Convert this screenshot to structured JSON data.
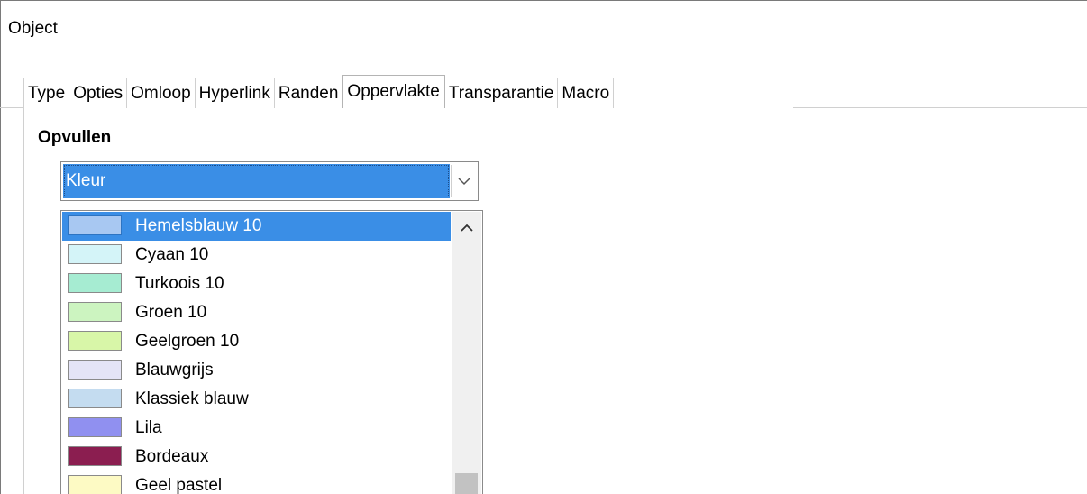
{
  "dialog": {
    "title": "Object"
  },
  "tabs": [
    {
      "label": "Type"
    },
    {
      "label": "Opties"
    },
    {
      "label": "Omloop"
    },
    {
      "label": "Hyperlink"
    },
    {
      "label": "Randen"
    },
    {
      "label": "Oppervlakte",
      "active": true
    },
    {
      "label": "Transparantie"
    },
    {
      "label": "Macro"
    }
  ],
  "fill": {
    "section_label": "Opvullen",
    "type_select": {
      "value": "Kleur",
      "icon": "chevron-down-icon"
    },
    "color_list": {
      "scroll_up_icon": "chevron-up-icon",
      "items": [
        {
          "label": "Hemelsblauw 10",
          "color": "#a8c8f2",
          "selected": true
        },
        {
          "label": "Cyaan 10",
          "color": "#d4f4f8"
        },
        {
          "label": "Turkoois 10",
          "color": "#a6ecd2"
        },
        {
          "label": "Groen 10",
          "color": "#ccf4c0"
        },
        {
          "label": "Geelgroen 10",
          "color": "#d8f6a8"
        },
        {
          "label": "Blauwgrijs",
          "color": "#e4e4f6"
        },
        {
          "label": "Klassiek blauw",
          "color": "#c4dcf0"
        },
        {
          "label": "Lila",
          "color": "#9090f0"
        },
        {
          "label": "Bordeaux",
          "color": "#8b1e50"
        },
        {
          "label": "Geel pastel",
          "color": "#fdfac4"
        }
      ]
    }
  },
  "colors": {
    "selection": "#3a8ee6",
    "accent": "#3a8ee6"
  }
}
